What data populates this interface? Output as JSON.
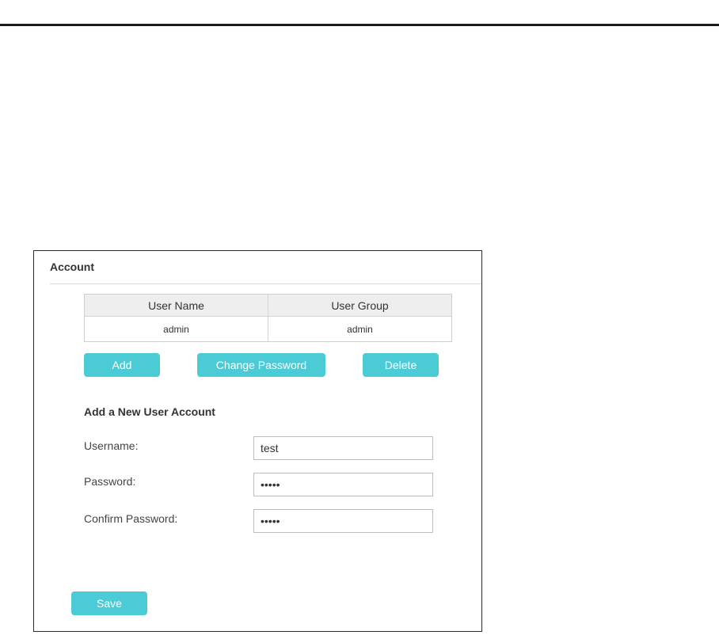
{
  "account": {
    "title": "Account",
    "table": {
      "headers": [
        "User Name",
        "User Group"
      ],
      "rows": [
        [
          "admin",
          "admin"
        ]
      ]
    },
    "buttons": {
      "add": "Add",
      "change_password": "Change Password",
      "delete": "Delete"
    },
    "new_account": {
      "title": "Add a New User Account",
      "username_label": "Username:",
      "username_value": "test",
      "password_label": "Password:",
      "password_value": "12345",
      "confirm_label": "Confirm Password:",
      "confirm_value": "12345"
    },
    "save_label": "Save"
  },
  "colors": {
    "button": "#4acbd6",
    "table_header": "#eeeeee"
  }
}
